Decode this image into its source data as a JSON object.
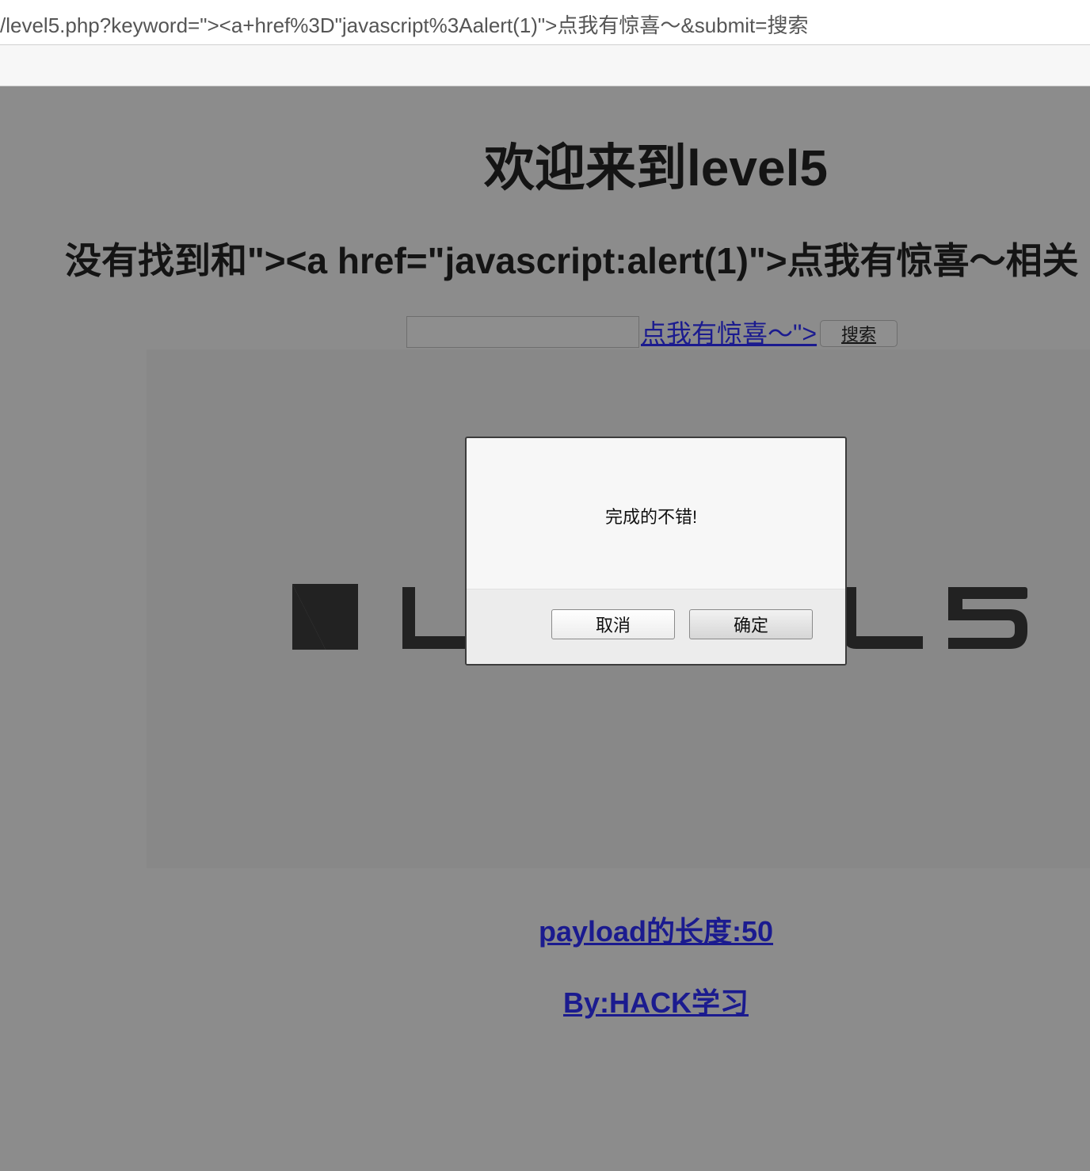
{
  "browser": {
    "url": "/level5.php?keyword=\"><a+href%3D\"javascript%3Aalert(1)\">点我有惊喜～&submit=搜索"
  },
  "page": {
    "title": "欢迎来到level5",
    "result_text": "没有找到和\"><a href=\"javascript:alert(1)\">点我有惊喜～相关",
    "search": {
      "input_value": "",
      "injected_link_text": "点我有惊喜～\">",
      "button_label": "搜索"
    },
    "banner": {
      "logo_text": "LEVEL5"
    },
    "payload_length": "payload的长度:50",
    "author": "By:HACK学习"
  },
  "dialog": {
    "message": "完成的不错!",
    "cancel_label": "取消",
    "ok_label": "确定"
  },
  "colors": {
    "overlay_gray": "#8c8c8c",
    "link_blue": "#1b1b8f",
    "dialog_bg": "#f7f7f7"
  }
}
